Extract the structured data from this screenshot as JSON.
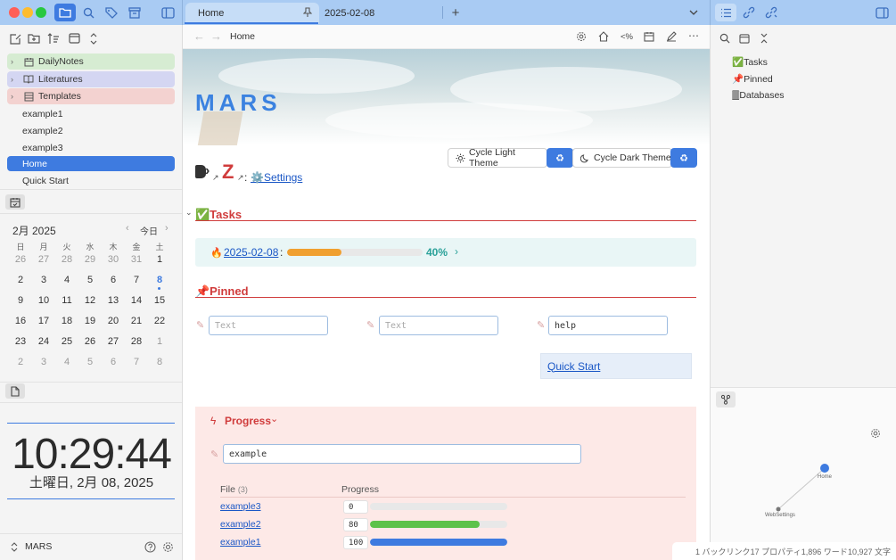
{
  "tabs": {
    "home_tab": "Home",
    "date_tab": "2025-02-08"
  },
  "breadcrumb": {
    "title": "Home",
    "code_label": "<%"
  },
  "sidebar": {
    "folders": [
      "DailyNotes",
      "Literatures",
      "Templates"
    ],
    "files": [
      "example1",
      "example2",
      "example3",
      "Home",
      "Quick Start"
    ],
    "vault_name": "MARS"
  },
  "calendar": {
    "month_label": "2月 2025",
    "today_label": "今日",
    "dow": [
      "日",
      "月",
      "火",
      "水",
      "木",
      "金",
      "土"
    ],
    "weeks": [
      [
        "26",
        "27",
        "28",
        "29",
        "30",
        "31",
        "1"
      ],
      [
        "2",
        "3",
        "4",
        "5",
        "6",
        "7",
        "8"
      ],
      [
        "9",
        "10",
        "11",
        "12",
        "13",
        "14",
        "15"
      ],
      [
        "16",
        "17",
        "18",
        "19",
        "20",
        "21",
        "22"
      ],
      [
        "23",
        "24",
        "25",
        "26",
        "27",
        "28",
        "1"
      ],
      [
        "2",
        "3",
        "4",
        "5",
        "6",
        "7",
        "8"
      ]
    ]
  },
  "clock": {
    "time": "10:29:44",
    "date": "土曜日, 2月 08, 2025"
  },
  "main": {
    "banner_title": "MARS",
    "cycle_light": "Cycle Light Theme",
    "cycle_dark": "Cycle Dark Theme",
    "z_letter": "Z",
    "colon": ":",
    "settings_link": "⚙️Settings",
    "tasks_heading": "✅Tasks",
    "task_date_link": "2025-02-08",
    "task_percent": "40%",
    "task_progress": 0.4,
    "pinned_heading": "📌Pinned",
    "input1_placeholder": "Text",
    "input2_placeholder": "Text",
    "input3_value": "help",
    "quick_start_link": "Quick Start",
    "progress_heading": "Progress",
    "progress_input_value": "example",
    "table_file_header": "File",
    "table_file_count": "(3)",
    "table_progress_header": "Progress",
    "rows": [
      {
        "name": "example3",
        "value": "0",
        "fill": 0.0,
        "color": "#e2e2e2"
      },
      {
        "name": "example2",
        "value": "80",
        "fill": 0.8,
        "color": "#5cc24a"
      },
      {
        "name": "example1",
        "value": "100",
        "fill": 1.0,
        "color": "#3e7be0"
      }
    ]
  },
  "outline": {
    "items": [
      "✅Tasks",
      "📌Pinned",
      "🀫Databases"
    ]
  },
  "graph": {
    "node_home": "Home",
    "node_websettings": "WebSettings"
  },
  "status": {
    "backlinks": "1 バックリンク",
    "properties": "17 プロパティ",
    "words": "1,896 ワード",
    "chars": "10,927 文字"
  },
  "colors": {
    "accent": "#3e7be0",
    "heading_red": "#d03c3c",
    "task_bar": "#f0a030"
  }
}
